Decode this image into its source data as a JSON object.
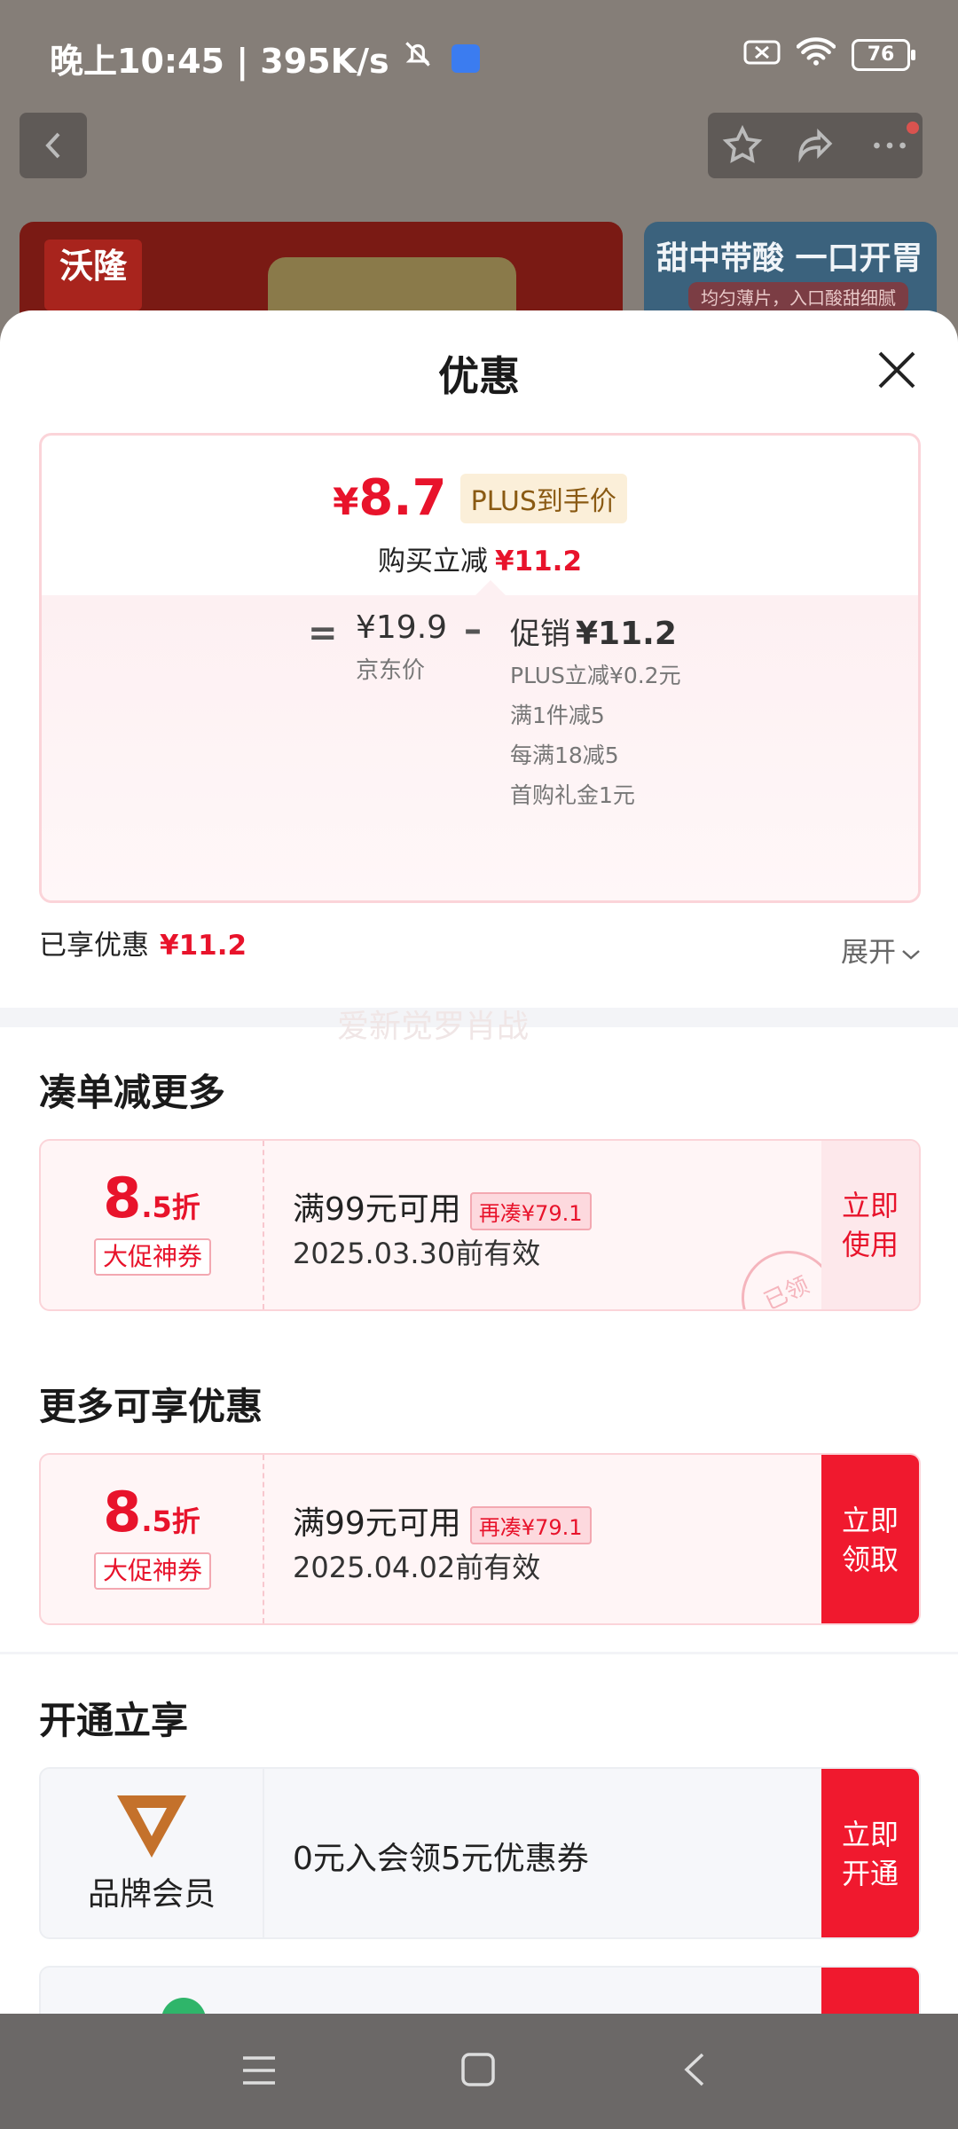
{
  "status_bar": {
    "time_speed": "晚上10:45 | 395K/s",
    "battery": "76"
  },
  "background": {
    "card1_logo": "沃隆",
    "card2_title": "甜中带酸 一口开胃",
    "card2_sub": "均匀薄片，入口酸甜细腻"
  },
  "sheet": {
    "title": "优惠",
    "final_price_symbol": "¥",
    "final_price_value": "8.7",
    "plus_tag": "PLUS到手价",
    "reduce_label": "购买立减",
    "reduce_value": "¥11.2",
    "equals": "=",
    "jd_price": "¥19.9",
    "jd_label": "京东价",
    "minus": "–",
    "promo_label": "促销",
    "promo_value": "¥11.2",
    "promo_items": [
      "PLUS立减¥0.2元",
      "满1件减5",
      "每满18减5",
      "首购礼金1元"
    ],
    "enjoyed_label": "已享优惠",
    "enjoyed_value": "¥11.2",
    "expand_label": "展开",
    "watermark": "爱新觉罗肖战"
  },
  "sections": {
    "more_reduce": "凑单减更多",
    "more_offers": "更多可享优惠",
    "open_enjoy": "开通立享"
  },
  "coupons": [
    {
      "discount_big": "8",
      "discount_small": ".5折",
      "tag": "大促神券",
      "condition": "满99元可用",
      "add_more": "再凑¥79.1",
      "validity": "2025.03.30前有效",
      "action": "立即使用",
      "stamp": "已领"
    },
    {
      "discount_big": "8",
      "discount_small": ".5折",
      "tag": "大促神券",
      "condition": "满99元可用",
      "add_more": "再凑¥79.1",
      "validity": "2025.04.02前有效",
      "action": "立即领取"
    }
  ],
  "membership": {
    "name": "品牌会员",
    "text": "0元入会领5元优惠券",
    "action": "立即开通"
  },
  "colors": {
    "accent_red": "#e8132b",
    "button_red": "#f0192e",
    "coupon_bg": "#fff5f6",
    "member_logo": "#c4712b"
  }
}
